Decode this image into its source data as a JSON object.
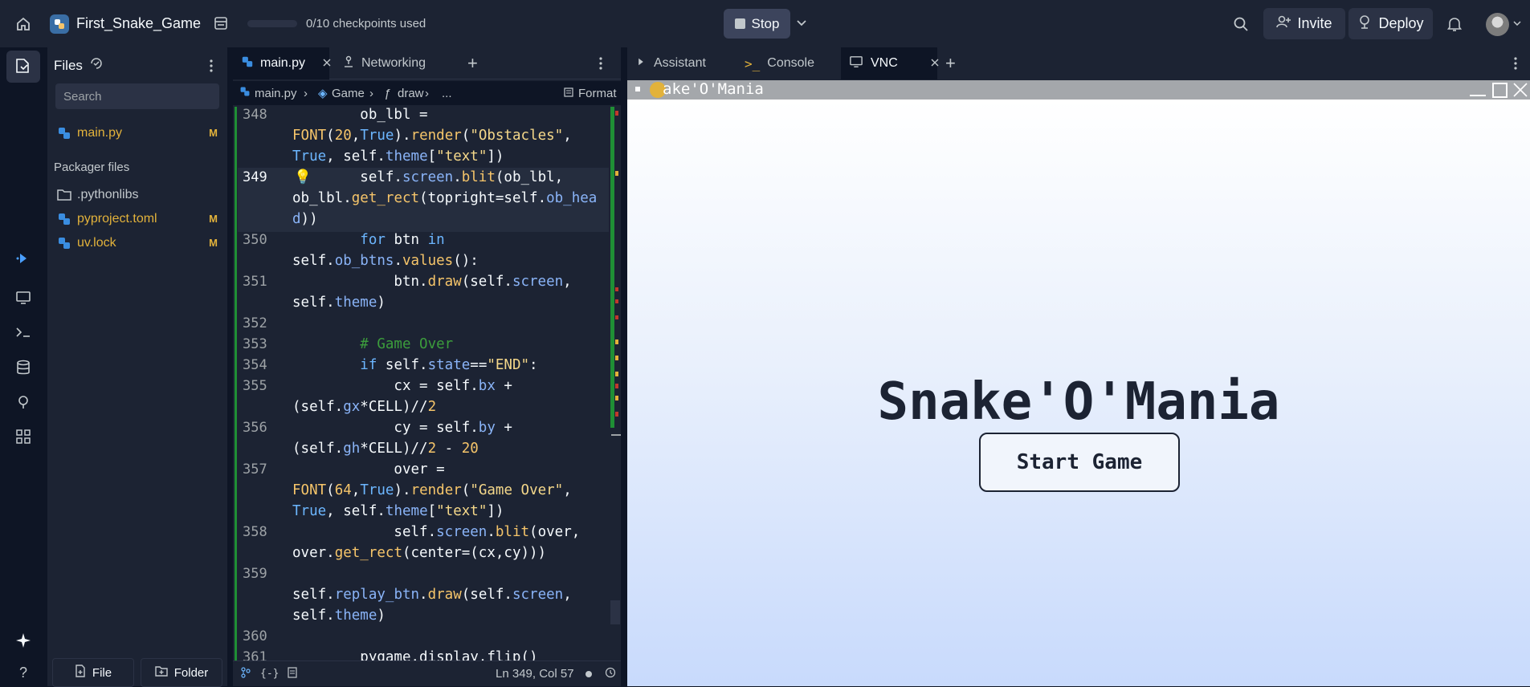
{
  "topbar": {
    "repl_name": "First_Snake_Game",
    "checkpoints": "0/10 checkpoints used",
    "stop_label": "Stop",
    "invite_label": "Invite",
    "deploy_label": "Deploy"
  },
  "files": {
    "title": "Files",
    "search_placeholder": "Search",
    "items": [
      {
        "name": "main.py",
        "badge": "M"
      }
    ],
    "section": "Packager files",
    "packager": [
      {
        "name": ".pythonlibs",
        "badge": ""
      },
      {
        "name": "pyproject.toml",
        "badge": "M"
      },
      {
        "name": "uv.lock",
        "badge": "M"
      }
    ],
    "file_btn": "File",
    "folder_btn": "Folder"
  },
  "editor": {
    "tabs": [
      "main.py",
      "Networking"
    ],
    "breadcrumb": [
      "main.py",
      "Game",
      "draw",
      "..."
    ],
    "format_label": "Format",
    "status": "Ln 349, Col 57",
    "line_numbers": [
      "348",
      "349",
      "350",
      "351",
      "352",
      "353",
      "354",
      "355",
      "356",
      "357",
      "358",
      "359",
      "360",
      "361"
    ]
  },
  "right": {
    "tabs": [
      "Assistant",
      "Console",
      "VNC"
    ],
    "vnc_window_title": "ake'O'Mania"
  },
  "game": {
    "title": "Snake'O'Mania",
    "start_label": "Start Game"
  },
  "colors": {
    "bg": "#0e1525",
    "panel": "#1c2333",
    "accent_modified": "#e2b23b",
    "git_bar": "#1f8f35"
  }
}
